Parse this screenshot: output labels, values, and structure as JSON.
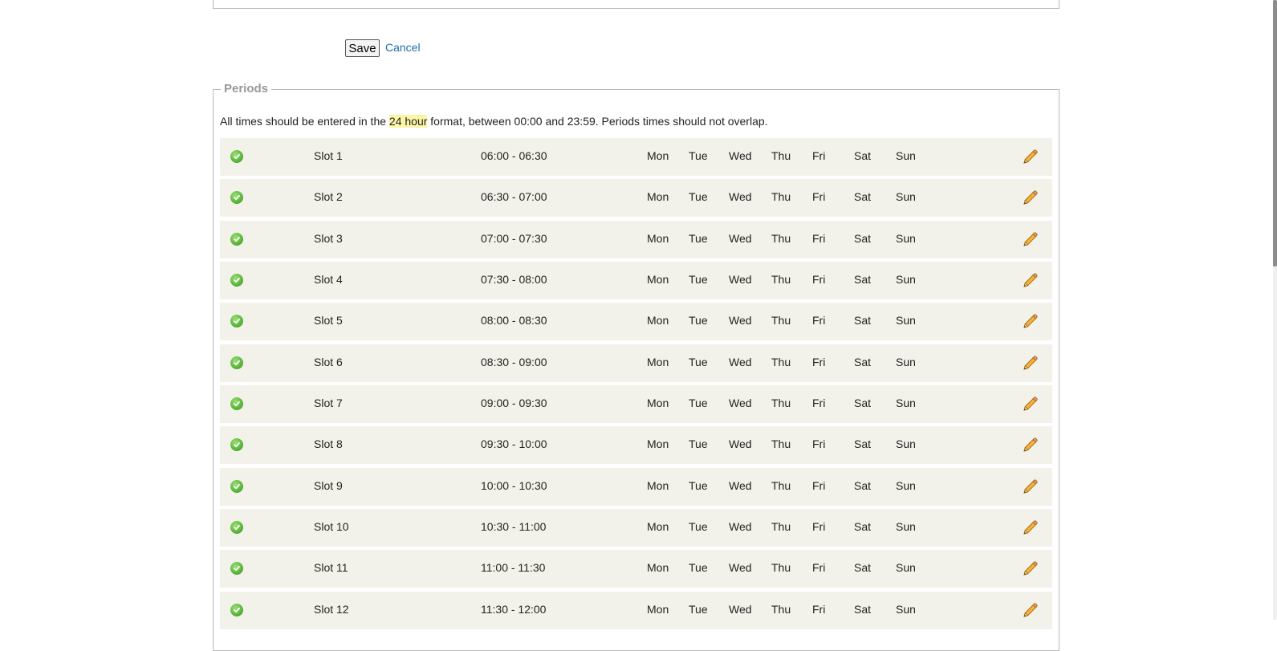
{
  "form": {
    "save_label": "Save",
    "cancel_label": "Cancel"
  },
  "periods": {
    "legend": "Periods",
    "info_before": "All times should be entered in the ",
    "info_highlight": "24 hour",
    "info_after": " format, between 00:00 and 23:59. Periods times should not overlap.",
    "rows": [
      {
        "name": "Slot 1",
        "time": "06:00 - 06:30",
        "days": [
          "Mon",
          "Tue",
          "Wed",
          "Thu",
          "Fri",
          "Sat",
          "Sun"
        ]
      },
      {
        "name": "Slot 2",
        "time": "06:30 - 07:00",
        "days": [
          "Mon",
          "Tue",
          "Wed",
          "Thu",
          "Fri",
          "Sat",
          "Sun"
        ]
      },
      {
        "name": "Slot 3",
        "time": "07:00 - 07:30",
        "days": [
          "Mon",
          "Tue",
          "Wed",
          "Thu",
          "Fri",
          "Sat",
          "Sun"
        ]
      },
      {
        "name": "Slot 4",
        "time": "07:30 - 08:00",
        "days": [
          "Mon",
          "Tue",
          "Wed",
          "Thu",
          "Fri",
          "Sat",
          "Sun"
        ]
      },
      {
        "name": "Slot 5",
        "time": "08:00 - 08:30",
        "days": [
          "Mon",
          "Tue",
          "Wed",
          "Thu",
          "Fri",
          "Sat",
          "Sun"
        ]
      },
      {
        "name": "Slot 6",
        "time": "08:30 - 09:00",
        "days": [
          "Mon",
          "Tue",
          "Wed",
          "Thu",
          "Fri",
          "Sat",
          "Sun"
        ]
      },
      {
        "name": "Slot 7",
        "time": "09:00 - 09:30",
        "days": [
          "Mon",
          "Tue",
          "Wed",
          "Thu",
          "Fri",
          "Sat",
          "Sun"
        ]
      },
      {
        "name": "Slot 8",
        "time": "09:30 - 10:00",
        "days": [
          "Mon",
          "Tue",
          "Wed",
          "Thu",
          "Fri",
          "Sat",
          "Sun"
        ]
      },
      {
        "name": "Slot 9",
        "time": "10:00 - 10:30",
        "days": [
          "Mon",
          "Tue",
          "Wed",
          "Thu",
          "Fri",
          "Sat",
          "Sun"
        ]
      },
      {
        "name": "Slot 10",
        "time": "10:30 - 11:00",
        "days": [
          "Mon",
          "Tue",
          "Wed",
          "Thu",
          "Fri",
          "Sat",
          "Sun"
        ]
      },
      {
        "name": "Slot 11",
        "time": "11:00 - 11:30",
        "days": [
          "Mon",
          "Tue",
          "Wed",
          "Thu",
          "Fri",
          "Sat",
          "Sun"
        ]
      },
      {
        "name": "Slot 12",
        "time": "11:30 - 12:00",
        "days": [
          "Mon",
          "Tue",
          "Wed",
          "Thu",
          "Fri",
          "Sat",
          "Sun"
        ]
      }
    ]
  },
  "icons": {
    "status": "check-circle-icon",
    "edit": "pencil-icon"
  },
  "colors": {
    "link": "#1a6eb0",
    "highlight": "#fbf5a6",
    "row_background": "#f3f2ea",
    "legend_text": "#999999",
    "check_green": "#5fb83c",
    "pencil": "#f0b030"
  }
}
